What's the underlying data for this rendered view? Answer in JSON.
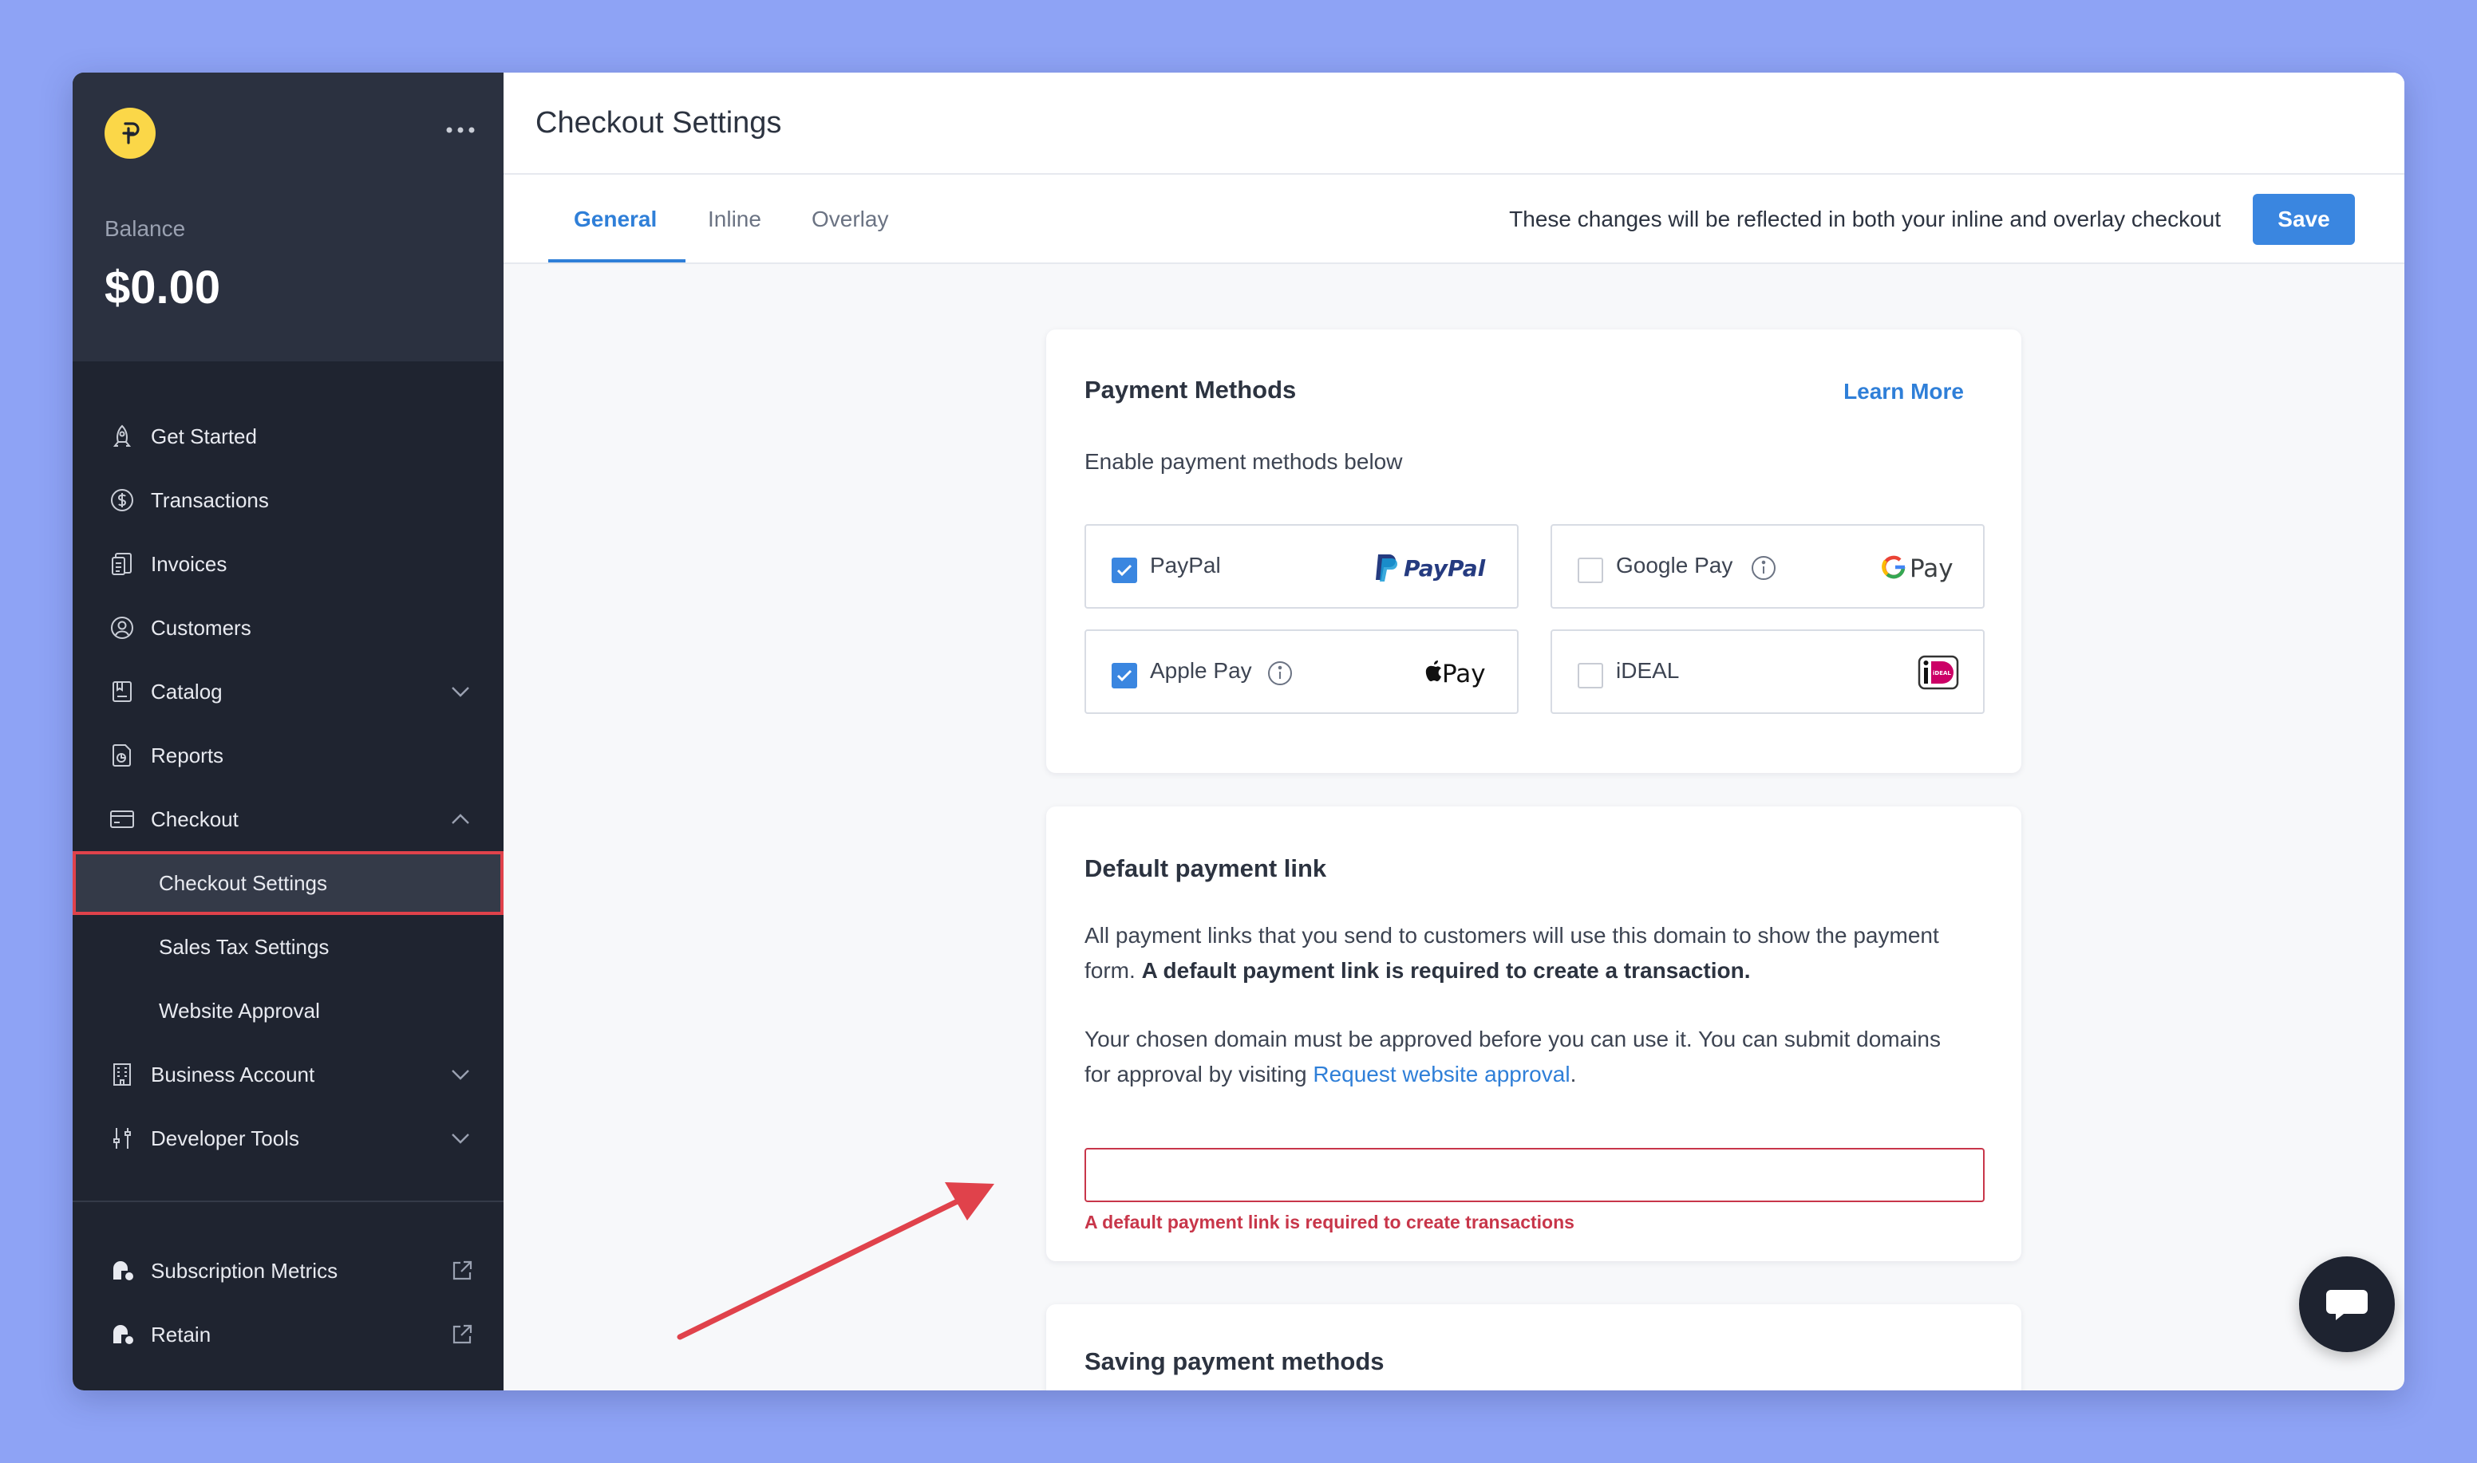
{
  "sidebar": {
    "balance_label": "Balance",
    "balance_value": "$0.00",
    "items": [
      {
        "label": "Get Started",
        "icon": "rocket-icon"
      },
      {
        "label": "Transactions",
        "icon": "dollar-circle-icon"
      },
      {
        "label": "Invoices",
        "icon": "invoice-icon"
      },
      {
        "label": "Customers",
        "icon": "user-circle-icon"
      },
      {
        "label": "Catalog",
        "icon": "catalog-icon"
      },
      {
        "label": "Reports",
        "icon": "reports-icon"
      },
      {
        "label": "Checkout",
        "icon": "card-icon"
      }
    ],
    "checkout_sub": [
      "Checkout Settings",
      "Sales Tax Settings",
      "Website Approval"
    ],
    "items_after": [
      {
        "label": "Business Account",
        "icon": "building-icon"
      },
      {
        "label": "Developer Tools",
        "icon": "sliders-icon"
      }
    ],
    "bottom": [
      {
        "label": "Subscription Metrics",
        "icon": "profitwell-icon"
      },
      {
        "label": "Retain",
        "icon": "profitwell-icon"
      }
    ]
  },
  "header": {
    "title": "Checkout Settings"
  },
  "tabs": {
    "items": [
      "General",
      "Inline",
      "Overlay"
    ],
    "active": "General",
    "note": "These changes will be reflected in both your inline and overlay checkout",
    "save_label": "Save"
  },
  "payment_methods": {
    "title": "Payment Methods",
    "learn_more": "Learn More",
    "subtitle": "Enable payment methods below",
    "methods": [
      {
        "label": "PayPal",
        "checked": true,
        "brand": "PayPal"
      },
      {
        "label": "Google Pay",
        "checked": false,
        "brand": "Pay"
      },
      {
        "label": "Apple Pay",
        "checked": true,
        "brand": "Pay"
      },
      {
        "label": "iDEAL",
        "checked": false,
        "brand": "iDEAL"
      }
    ]
  },
  "default_link": {
    "title": "Default payment link",
    "para1_a": "All payment links that you send to customers will use this domain to show the payment form. ",
    "para1_b": "A default payment link is required to create a transaction.",
    "para2_a": "Your chosen domain must be approved before you can use it. You can submit domains for approval by visiting ",
    "para2_link": "Request website approval",
    "para2_end": ".",
    "input_value": "",
    "error": "A default payment link is required to create transactions"
  },
  "saving": {
    "title": "Saving payment methods"
  },
  "colors": {
    "accent": "#3a86e0",
    "error": "#c8364a",
    "sidebar": "#1f2430",
    "background": "#8ea3f5",
    "annotation_arrow": "#e0424b"
  }
}
